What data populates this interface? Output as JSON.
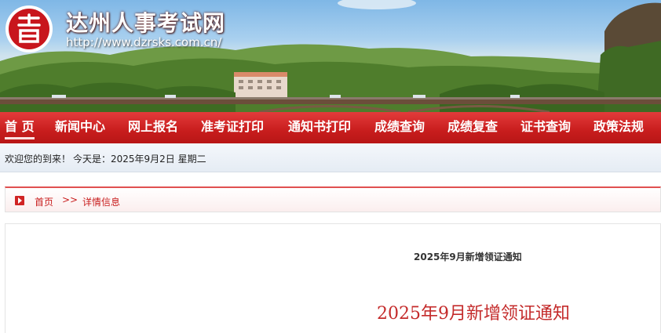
{
  "site": {
    "title": "达州人事考试网",
    "url": "http://www.dzrsks.com.cn/"
  },
  "nav": {
    "items": [
      {
        "label": "首 页",
        "active": true
      },
      {
        "label": "新闻中心"
      },
      {
        "label": "网上报名"
      },
      {
        "label": "准考证打印"
      },
      {
        "label": "通知书打印"
      },
      {
        "label": "成绩查询"
      },
      {
        "label": "成绩复查"
      },
      {
        "label": "证书查询"
      },
      {
        "label": "政策法规"
      }
    ]
  },
  "welcome": {
    "greeting": "欢迎您的到来！",
    "today": "今天是：2025年9月2日 星期二"
  },
  "breadcrumb": {
    "home": "首页",
    "separator": ">>",
    "current": "详情信息"
  },
  "article": {
    "title": "2025年9月新增领证通知",
    "heading": "2025年9月新增领证通知"
  },
  "colors": {
    "nav": "#c81d1d",
    "accent": "#c42b2b"
  }
}
